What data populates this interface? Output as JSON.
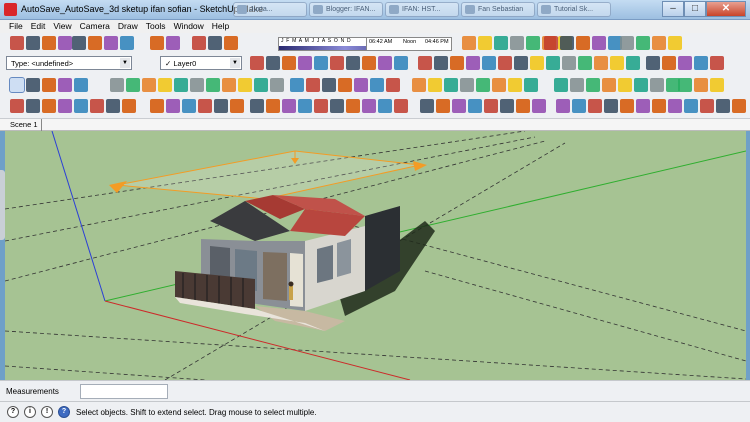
{
  "window": {
    "title": "AutoSave_AutoSave_3d sketup ifan sofian - SketchUp Make",
    "tabs": [
      "Juxta...",
      "Blogger: IFAN...",
      "IFAN: HST...",
      "Fan Sebastian",
      "Tutorial Sk..."
    ],
    "minimize": "–",
    "maximize": "□",
    "close": "✕"
  },
  "menu": [
    "File",
    "Edit",
    "View",
    "Camera",
    "Draw",
    "Tools",
    "Window",
    "Help"
  ],
  "toolbar": {
    "type_dropdown": "Type: <undefined>",
    "layer_dropdown": "Layer0",
    "layer_check": "✓",
    "months": "J F M A M J J A S O N D",
    "time_start": "06:42 AM",
    "time_noon": "Noon",
    "time_end": "04:46 PM"
  },
  "scene": {
    "tab": "Scene 1"
  },
  "measurements": {
    "label": "Measurements",
    "value": ""
  },
  "status": {
    "message": "Select objects. Shift to extend select. Drag mouse to select multiple.",
    "icons": [
      "?",
      "i",
      "!",
      "?"
    ]
  },
  "colors": {
    "viewport_ground": "#a6c393",
    "roof": "#c0524a",
    "selection": "#f39c25",
    "axis_red": "#cc2a2a",
    "axis_green": "#2fae2f",
    "axis_blue": "#2b3fd6"
  }
}
